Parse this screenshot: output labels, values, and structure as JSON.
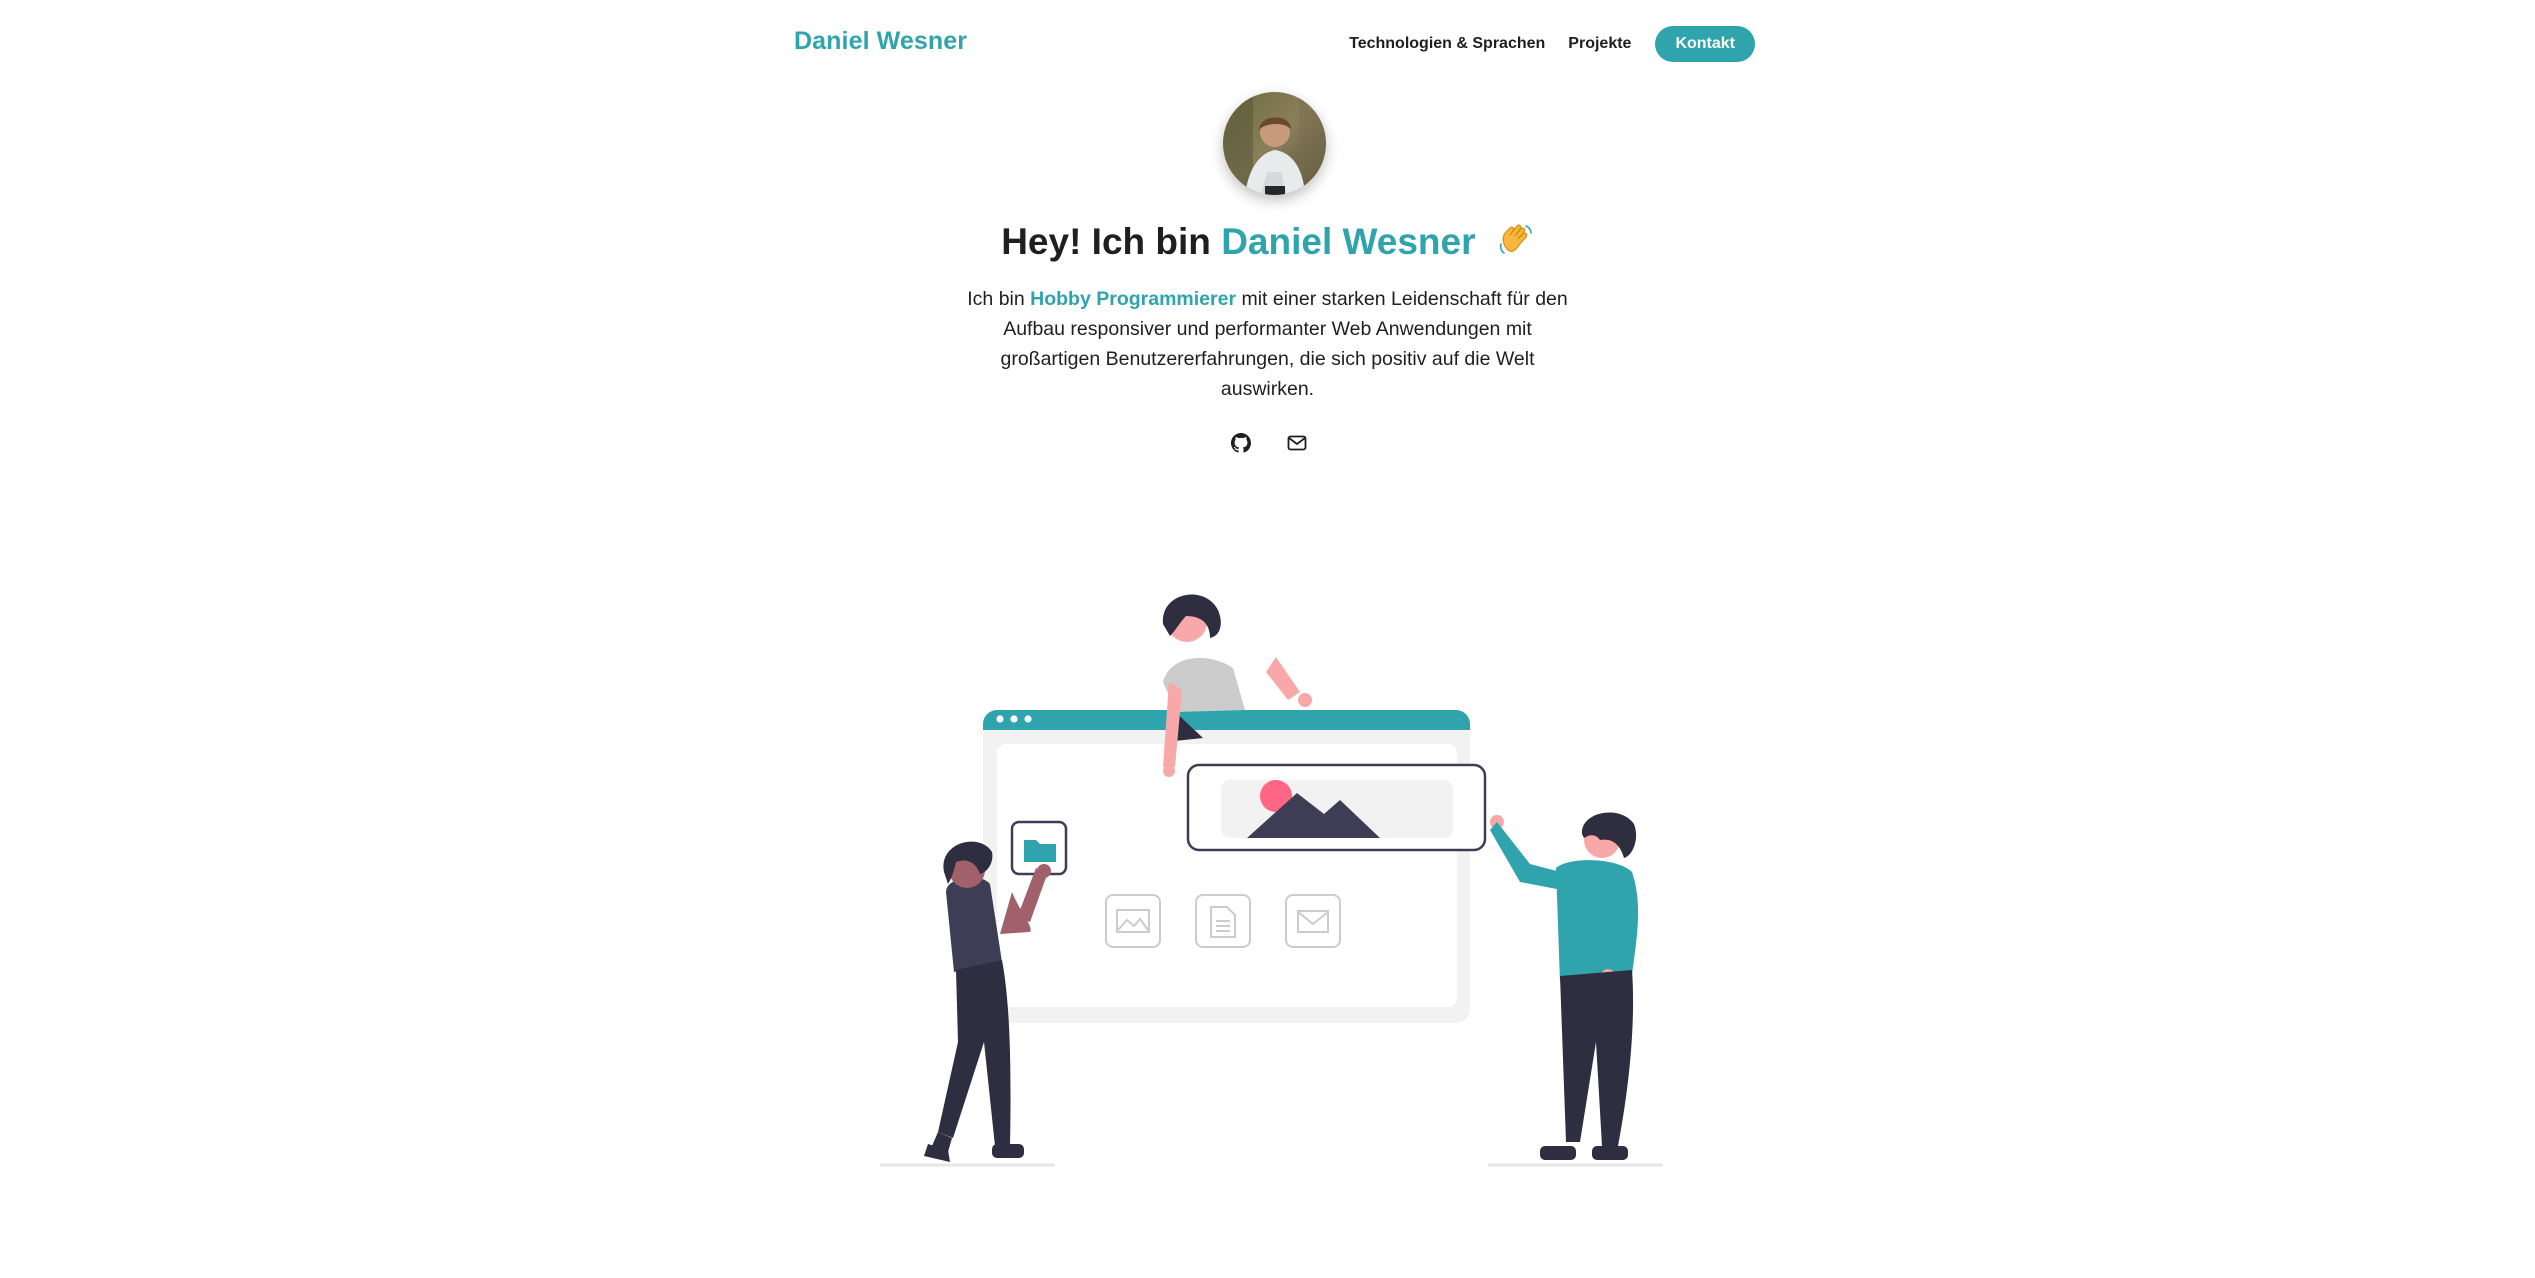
{
  "header": {
    "brand": "Daniel Wesner",
    "links": [
      {
        "label": "Technologien & Sprachen"
      },
      {
        "label": "Projekte"
      }
    ],
    "cta_label": "Kontakt"
  },
  "hero": {
    "greeting": "Hey! Ich bin",
    "name": "Daniel Wesner",
    "emoji": "wave-icon",
    "text_before": "Ich bin",
    "highlight": "Hobby Programmierer",
    "text_after": "mit einer starken Leidenschaft für den Aufbau responsiver und performanter Web Anwendungen mit großartigen Benutzererfahrungen, die sich positiv auf die Welt auswirken."
  },
  "socials": [
    {
      "icon": "github-icon"
    },
    {
      "icon": "mail-icon"
    }
  ],
  "colors": {
    "accent": "#2fa4ad",
    "text": "#1f1f1f",
    "illustration_dark": "#2f2e41",
    "illustration_pink": "#f8a8a8",
    "illustration_red": "#ff6584"
  }
}
